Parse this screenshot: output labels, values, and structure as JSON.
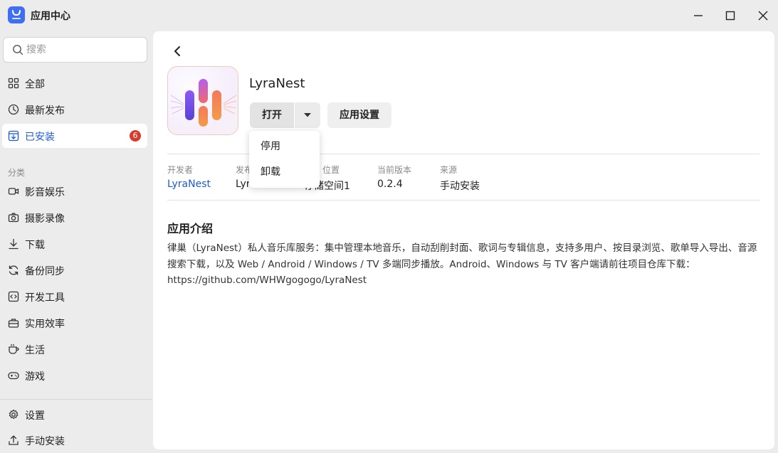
{
  "window": {
    "title": "应用中心",
    "logo_icon": "store-icon",
    "controls": [
      "minimize-icon",
      "maximize-icon",
      "close-icon"
    ]
  },
  "sidebar": {
    "search": {
      "placeholder": "搜索",
      "value": ""
    },
    "main_items": [
      {
        "label": "全部",
        "icon": "grid-icon"
      },
      {
        "label": "最新发布",
        "icon": "clock-icon"
      },
      {
        "label": "已安装",
        "icon": "installed-icon",
        "badge": "6",
        "active": true
      }
    ],
    "category_label": "分类",
    "categories": [
      {
        "label": "影音娱乐",
        "icon": "video-icon"
      },
      {
        "label": "摄影录像",
        "icon": "camera-icon"
      },
      {
        "label": "下载",
        "icon": "download-icon"
      },
      {
        "label": "备份同步",
        "icon": "sync-icon"
      },
      {
        "label": "开发工具",
        "icon": "code-icon"
      },
      {
        "label": "实用效率",
        "icon": "toolbox-icon"
      },
      {
        "label": "生活",
        "icon": "cup-icon"
      },
      {
        "label": "游戏",
        "icon": "gamepad-icon"
      }
    ],
    "bottom_items": [
      {
        "label": "设置",
        "icon": "gear-icon"
      },
      {
        "label": "手动安装",
        "icon": "upload-icon"
      }
    ]
  },
  "app": {
    "name": "LyraNest",
    "open_label": "打开",
    "settings_label": "应用设置",
    "dropdown": [
      "停用",
      "卸载"
    ],
    "meta": [
      {
        "label": "开发者",
        "value": "LyraNest",
        "link": true
      },
      {
        "label": "发布",
        "value": "Lyr"
      },
      {
        "label": "位置",
        "value": "存储空间1"
      },
      {
        "label": "当前版本",
        "value": "0.2.4"
      },
      {
        "label": "来源",
        "value": "手动安装"
      }
    ],
    "intro_title": "应用介绍",
    "intro_text": "律巢（LyraNest）私人音乐库服务：集中管理本地音乐，自动刮削封面、歌词与专辑信息，支持多用户、按目录浏览、歌单导入导出、音源搜索下载，以及 Web / Android / Windows / TV 多端同步播放。Android、Windows 与 TV 客户端请前往项目仓库下载：https://github.com/WHWgogogo/LyraNest"
  },
  "colors": {
    "accent": "#1c5bd6",
    "badge": "#d93a2b",
    "logo": "#3d6ef5"
  }
}
